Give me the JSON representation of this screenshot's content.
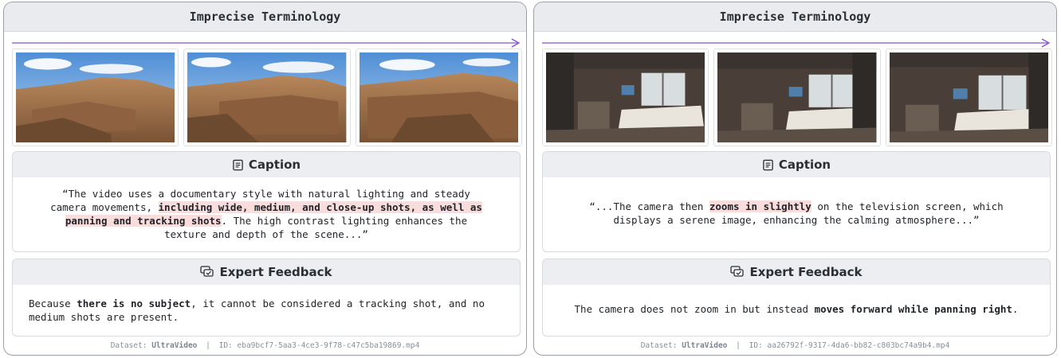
{
  "panels": [
    {
      "title": "Imprecise Terminology",
      "frame_scene": "desert-ruins",
      "caption_heading": "Caption",
      "caption": {
        "open": "“The video uses a documentary style with natural lighting and steady camera movements, ",
        "highlight": "including wide, medium, and close-up shots, as well as panning and tracking shots",
        "close": ". The high contrast lighting enhances the texture and depth of the scene...”"
      },
      "feedback_heading": "Expert Feedback",
      "feedback": {
        "pre": "Because ",
        "bold": "there is no subject",
        "post": ", it cannot be considered a tracking shot, and no medium shots are present."
      },
      "footer": {
        "dataset_label": "Dataset:",
        "dataset": "UltraVideo",
        "separator": "|",
        "id_label": "ID:",
        "id": "eba9bcf7-5aa3-4ce3-9f78-c47c5ba19869.mp4"
      }
    },
    {
      "title": "Imprecise Terminology",
      "frame_scene": "hotel-bedroom",
      "caption_heading": "Caption",
      "caption": {
        "open": "“...The camera then ",
        "highlight": "zooms in slightly",
        "close": " on the television screen, which displays a serene image, enhancing the calming atmosphere...”"
      },
      "feedback_heading": "Expert Feedback",
      "feedback": {
        "pre": "The camera does not zoom in but instead ",
        "bold": "moves forward while panning right",
        "post": "."
      },
      "footer": {
        "dataset_label": "Dataset:",
        "dataset": "UltraVideo",
        "separator": "|",
        "id_label": "ID:",
        "id": "aa26792f-9317-4da6-bb82-c803bc74a9b4.mp4"
      }
    }
  ],
  "icons": {
    "caption": "document-icon",
    "feedback": "chat-check-icon",
    "timeline": "arrow-right-icon"
  },
  "colors": {
    "highlight": "#f9dcdc",
    "arrow": "#8a4fd0",
    "header_bg": "#e9ebee"
  }
}
